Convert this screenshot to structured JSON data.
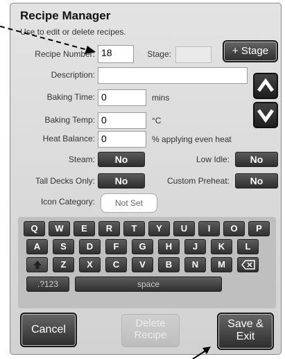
{
  "header": {
    "title": "Recipe Manager",
    "subtitle": "Use to edit or delete recipes."
  },
  "form": {
    "recipe_number_label": "Recipe Number:",
    "recipe_number": "18",
    "stage_label": "Stage:",
    "stage_value": "",
    "add_stage_label": "+ Stage",
    "description_label": "Description:",
    "description": "",
    "baking_time_label": "Baking Time:",
    "baking_time": "0",
    "baking_time_unit": "mins",
    "baking_temp_label": "Baking Temp:",
    "baking_temp": "0",
    "baking_temp_unit": "°C",
    "heat_balance_label": "Heat Balance:",
    "heat_balance": "0",
    "heat_balance_unit": "% applying even heat",
    "steam_label": "Steam:",
    "steam_value": "No",
    "low_idle_label": "Low Idle:",
    "low_idle_value": "No",
    "tall_decks_label": "Tall Decks Only:",
    "tall_decks_value": "No",
    "custom_preheat_label": "Custom Preheat:",
    "custom_preheat_value": "No",
    "icon_category_label": "Icon Category:",
    "icon_category_value": "Not Set"
  },
  "keyboard": {
    "row1": [
      "Q",
      "W",
      "E",
      "R",
      "T",
      "Y",
      "U",
      "I",
      "O",
      "P"
    ],
    "row2": [
      "A",
      "S",
      "D",
      "F",
      "G",
      "H",
      "J",
      "K",
      "L"
    ],
    "row3": [
      "Z",
      "X",
      "C",
      "V",
      "B",
      "N",
      "M"
    ],
    "symbols_label": ".?123",
    "space_label": "space"
  },
  "actions": {
    "cancel": "Cancel",
    "delete_line1": "Delete",
    "delete_line2": "Recipe",
    "save_line1": "Save &",
    "save_line2": "Exit"
  }
}
